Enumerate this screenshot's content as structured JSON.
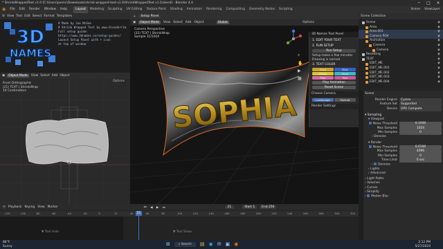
{
  "window": {
    "title": "* ShrinkWrappedText v1.0 [C:\\Users\\joemc\\Downloads\\shrink-wrapped-text-v1.0\\ShrinkWrappedText v1.0.blend] - Blender 4.0",
    "minimize": "─",
    "maximize": "□",
    "close": "✕"
  },
  "menu": {
    "items": [
      "File",
      "Edit",
      "Render",
      "Window",
      "Help"
    ],
    "workspaces": [
      "Layout",
      "Modeling",
      "Sculpting",
      "UV Editing",
      "Texture Paint",
      "Shading",
      "Animation",
      "Rendering",
      "Compositing",
      "Geometry Nodes",
      "Scripting"
    ],
    "active_workspace": "Layout",
    "scene_label": "Scene",
    "view_layer_label": "ViewLayer"
  },
  "text_editor": {
    "header": [
      "View",
      "Text",
      "Edit",
      "Select",
      "Format",
      "Templates"
    ],
    "lines": [
      "# Made by Joe McGee",
      "# Shrink Wrapped Text by www.blenderrim",
      "",
      "Full setup guide:",
      "https://www.3dnames.co/setup-guides/",
      "",
      "Launch Setup Panel with + icon",
      "at top of window"
    ]
  },
  "logo": {
    "text_top": "3D",
    "text_bottom": "NAMES"
  },
  "uv_editor": {
    "header": [
      "Object Mode",
      "View",
      "Select",
      "Add",
      "Object"
    ],
    "overlay": [
      "Front Orthographic",
      "(21) TEXT | ShrinkWrap",
      "10 Centimeters"
    ],
    "options": "Options"
  },
  "viewport": {
    "header_top": [
      "Setup Panel"
    ],
    "header": [
      "Object Mode",
      "View",
      "Select",
      "Add",
      "Object",
      "Global"
    ],
    "overlay": [
      "Camera Perspective",
      "(21) TEXT | ShrinkWrap",
      "Sample 31/1024"
    ],
    "options": "Options",
    "name_text": "SOPHIA"
  },
  "setup_panel": {
    "title": "3D Names Text Panel",
    "step1": "1. EDIT YOUR TEXT",
    "step2": "2. RUN SETUP",
    "run_setup": "Run Setup",
    "setup_note": "Setup takes a few minutes",
    "freezing_note": "Freezing is normal",
    "step3": "3. TEXT COLOR",
    "colors": [
      "Gold",
      "Blue",
      "Yellow",
      "Aqua",
      "Pink",
      "Pink"
    ],
    "color_hex": [
      "#c9a227",
      "#2f63c9",
      "#d8c43a",
      "#3fb7c6",
      "#d86aa6",
      "#c85a9a"
    ],
    "play_animation": "Play Animation",
    "reset_scene": "Reset Scene",
    "choose_camera": "Choose Camera",
    "landscape": "Landscape",
    "portrait": "Portrait",
    "render_settings": "Render Settings"
  },
  "outliner": {
    "header": "Scene Collection",
    "items": [
      {
        "label": "Scene",
        "indent": 1
      },
      {
        "label": "Area",
        "indent": 2
      },
      {
        "label": "Area.001",
        "indent": 2
      },
      {
        "label": "Camera POV",
        "indent": 2
      },
      {
        "label": "Animation",
        "indent": 2
      },
      {
        "label": "Camera",
        "indent": 3
      },
      {
        "label": "Camera",
        "indent": 4
      },
      {
        "label": "Resetting",
        "indent": 1
      },
      {
        "label": "TEXT",
        "indent": 1
      },
      {
        "label": "EDIT_ME",
        "indent": 2
      },
      {
        "label": "EDIT_ME.001",
        "indent": 2
      },
      {
        "label": "EDIT_ME.002",
        "indent": 2
      },
      {
        "label": "EDIT_ME.003",
        "indent": 2
      },
      {
        "label": "EDIT_ME.004",
        "indent": 2
      }
    ]
  },
  "properties": {
    "scene": "Scene",
    "render_engine_label": "Render Engine",
    "render_engine": "Cycles",
    "feature_set_label": "Feature Set",
    "feature_set": "Supported",
    "device_label": "Device",
    "device": "GPU Compute",
    "sampling": "Sampling",
    "viewport": "Viewport",
    "noise_threshold_label": "Noise Threshold",
    "noise_threshold_vp": "0.1000",
    "max_samples_label": "Max Samples",
    "max_samples_vp": "1024",
    "min_samples_label": "Min Samples",
    "min_samples_vp": "0",
    "denoise": "Denoise",
    "render": "Render",
    "noise_threshold_r": "0.0100",
    "max_samples_r": "4096",
    "min_samples_r": "0",
    "time_limit_label": "Time Limit",
    "time_limit": "0 sec",
    "denoise2": "Denoise",
    "lights": "Lights",
    "advanced": "Advanced",
    "sections": [
      "Light Paths",
      "Volumes",
      "Curves",
      "Simplify",
      "Motion Blur"
    ]
  },
  "timeline": {
    "header": [
      "Playback",
      "Keying",
      "View",
      "Marker"
    ],
    "current_frame": "21",
    "start_label": "Start",
    "start": "1",
    "end_label": "End",
    "end": "250",
    "ticks": [
      "-120",
      "-100",
      "-80",
      "-60",
      "-40",
      "-20",
      "0",
      "21",
      "40",
      "60",
      "80",
      "100",
      "120",
      "140",
      "160",
      "180",
      "200",
      "220",
      "240",
      "260",
      "280",
      "300",
      "320"
    ],
    "keys": [
      "Text Hide",
      "Text Show"
    ]
  },
  "taskbar": {
    "temp": "86°F",
    "weather": "Sunny",
    "search": "Search",
    "time": "2:12 PM",
    "date": "5/27/2024"
  }
}
